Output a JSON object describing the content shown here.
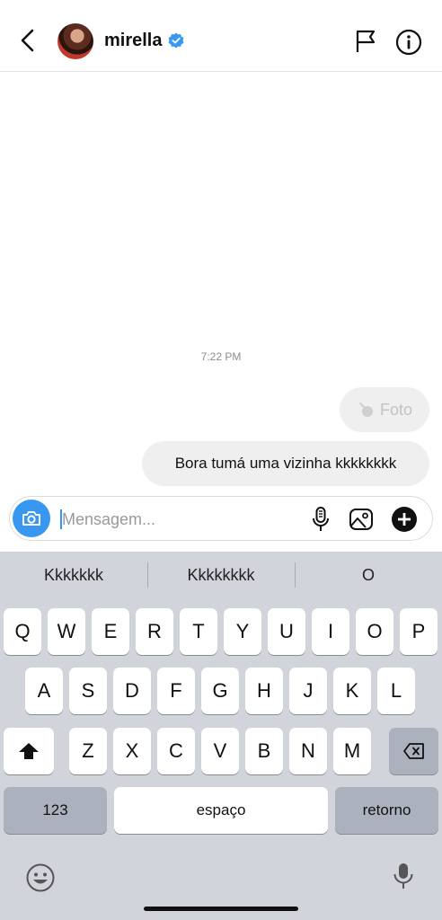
{
  "header": {
    "username": "mirella",
    "verified": true
  },
  "chat": {
    "timestamp": "7:22 PM",
    "messages": [
      {
        "type": "photo-sent",
        "label": "Foto"
      },
      {
        "type": "text-sent",
        "text": "Bora tumá uma vizinha kkkkkkkk"
      }
    ]
  },
  "composer": {
    "placeholder": "Mensagem...",
    "value": ""
  },
  "keyboard": {
    "suggestions": [
      "Kkkkkkk",
      "Kkkkkkkk",
      "O"
    ],
    "row1": [
      "Q",
      "W",
      "E",
      "R",
      "T",
      "Y",
      "U",
      "I",
      "O",
      "P"
    ],
    "row2": [
      "A",
      "S",
      "D",
      "F",
      "G",
      "H",
      "J",
      "K",
      "L"
    ],
    "row3": [
      "Z",
      "X",
      "C",
      "V",
      "B",
      "N",
      "M"
    ],
    "numbers_label": "123",
    "space_label": "espaço",
    "return_label": "retorno"
  },
  "colors": {
    "accent": "#3897f0",
    "bubble": "#efefef",
    "keyboard_bg": "#d1d4db"
  }
}
